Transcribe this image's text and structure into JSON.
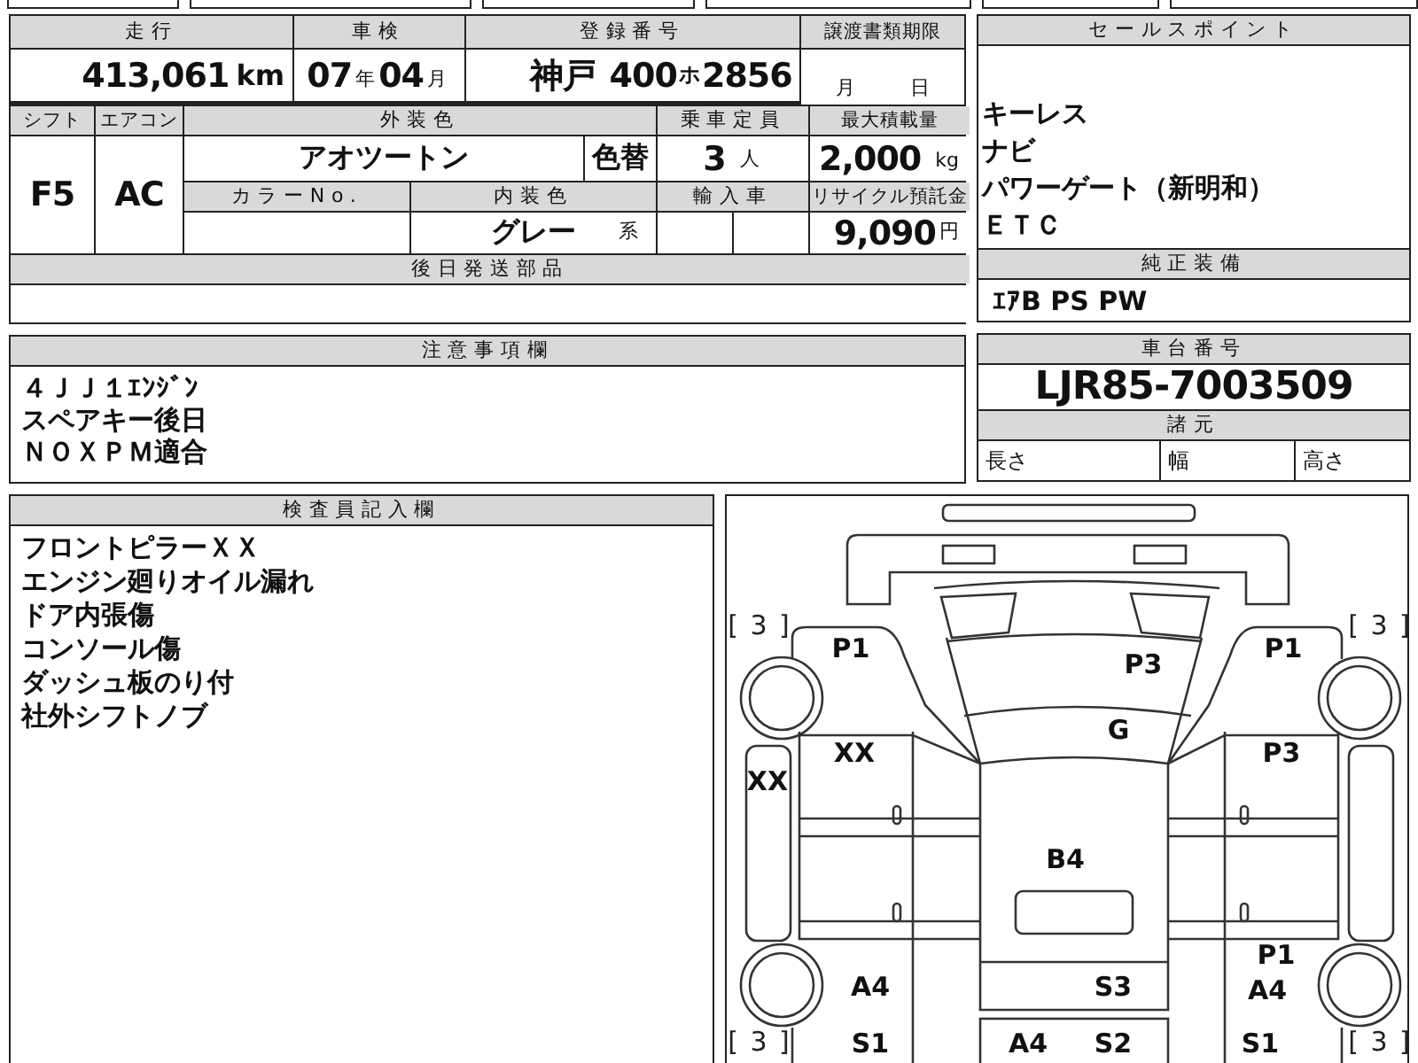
{
  "vehicle_table": {
    "mileage": {
      "label": "走行",
      "value": "413,061",
      "unit": "km"
    },
    "inspection": {
      "label": "車検",
      "year": "07",
      "year_unit": "年",
      "month": "04",
      "month_unit": "月"
    },
    "registration": {
      "label": "登録番号",
      "region": "神戸",
      "class": "400",
      "kana": "ホ",
      "serial": "2856"
    },
    "transfer_deadline": {
      "label": "譲渡書類期限",
      "month_unit": "月",
      "day_unit": "日"
    },
    "shift": {
      "label": "シフト",
      "value": "F5"
    },
    "aircon": {
      "label": "エアコン",
      "value": "AC"
    },
    "exterior_color": {
      "label": "外装色",
      "value": "アオツートン",
      "repaint": "色替"
    },
    "capacity": {
      "label": "乗車定員",
      "value": "3",
      "unit": "人"
    },
    "max_load": {
      "label": "最大積載量",
      "value": "2,000",
      "unit": "kg"
    },
    "color_no": {
      "label": "カラーNo."
    },
    "interior_color": {
      "label": "内装色",
      "value": "グレー",
      "suffix": "系"
    },
    "imported": {
      "label": "輸入車"
    },
    "recycle_fee": {
      "label": "リサイクル預託金",
      "value": "9,090",
      "unit": "円"
    },
    "later_parts": {
      "label": "後日発送部品"
    }
  },
  "sale_points": {
    "title": "セールスポイント",
    "items": [
      "キーレス",
      "ナビ",
      "パワーゲート（新明和）",
      "ＥＴＣ"
    ]
  },
  "genuine_equipment": {
    "title": "純正装備",
    "value": "ｴｱB PS PW"
  },
  "notes": {
    "title": "注意事項欄",
    "lines": [
      "４ＪＪ１ｴﾝｼﾞﾝ",
      "スペアキー後日",
      "ＮＯＸＰＭ適合"
    ]
  },
  "chassis": {
    "title": "車台番号",
    "value": "LJR85-7003509",
    "specs_title": "諸元",
    "specs": [
      "長さ",
      "幅",
      "高さ"
    ]
  },
  "inspector": {
    "title": "検査員記入欄",
    "lines": [
      "フロントピラーＸＸ",
      "エンジン廻りオイル漏れ",
      "ドア内張傷",
      "コンソール傷",
      "ダッシュ板のり付",
      "社外シフトノブ"
    ]
  },
  "diagram": {
    "marks": [
      {
        "kind": "count",
        "text": "[ 3 ]"
      },
      {
        "kind": "count",
        "text": "[ 3 ]"
      },
      {
        "kind": "damage",
        "text": "P1"
      },
      {
        "kind": "damage",
        "text": "P3"
      },
      {
        "kind": "damage",
        "text": "P1"
      },
      {
        "kind": "damage",
        "text": "G"
      },
      {
        "kind": "damage",
        "text": "XX"
      },
      {
        "kind": "damage",
        "text": "XX"
      },
      {
        "kind": "damage",
        "text": "P3"
      },
      {
        "kind": "damage",
        "text": "B4"
      },
      {
        "kind": "damage",
        "text": "P1"
      },
      {
        "kind": "damage",
        "text": "A4"
      },
      {
        "kind": "damage",
        "text": "S3"
      },
      {
        "kind": "damage",
        "text": "A4"
      },
      {
        "kind": "count",
        "text": "[ 3 ]"
      },
      {
        "kind": "damage",
        "text": "S1"
      },
      {
        "kind": "damage",
        "text": "A4"
      },
      {
        "kind": "damage",
        "text": "S2"
      },
      {
        "kind": "damage",
        "text": "S1"
      },
      {
        "kind": "count",
        "text": "[ 3 ]"
      }
    ]
  }
}
